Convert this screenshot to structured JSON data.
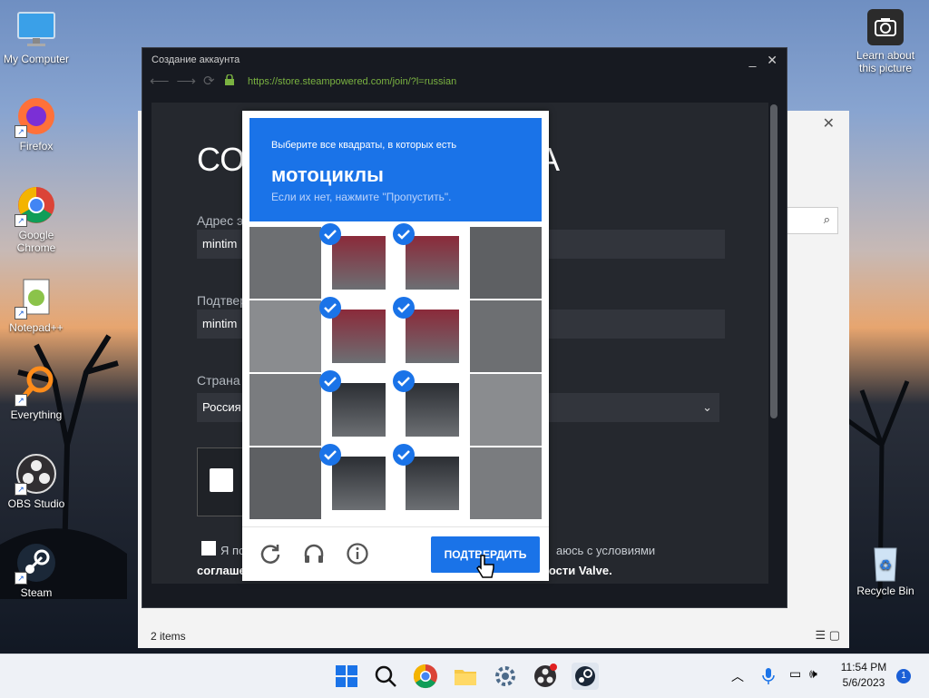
{
  "desktop": {
    "icons": [
      {
        "label": "My Computer"
      },
      {
        "label": "Firefox"
      },
      {
        "label": "Google Chrome"
      },
      {
        "label": "Notepad++"
      },
      {
        "label": "Everything"
      },
      {
        "label": "OBS Studio"
      },
      {
        "label": "Steam"
      }
    ],
    "learn_about": "Learn about this picture",
    "recycle_bin": "Recycle Bin"
  },
  "explorer": {
    "status_items": "2 items"
  },
  "steam_window": {
    "title": "Создание аккаунта",
    "url": "https://store.steampowered.com/join/?l=russian",
    "page_title_left": "СО",
    "page_title_right": "А",
    "email_label": "Адрес э",
    "email_value": "mintim",
    "confirm_label": "Подтвер",
    "confirm_value": "mintim",
    "country_label": "Страна",
    "country_value": "Россия",
    "agree_text_left": "Я по",
    "agree_text_right": "аюсь с условиями",
    "agreement_left": "соглаше",
    "agreement_right": "ности Valve."
  },
  "captcha": {
    "instruction": "Выберите все квадраты, в которых есть",
    "target": "мотоциклы",
    "hint": "Если их нет, нажмите \"Пропустить\".",
    "grid_selected": [
      [
        false,
        true,
        true,
        false
      ],
      [
        false,
        true,
        true,
        false
      ],
      [
        false,
        true,
        true,
        false
      ],
      [
        false,
        true,
        true,
        false
      ]
    ],
    "confirm_button": "ПОДТВЕРДИТЬ",
    "icons": [
      "reload-icon",
      "headphones-icon",
      "info-icon"
    ]
  },
  "taskbar": {
    "time": "11:54 PM",
    "date": "5/6/2023",
    "notifications": "1"
  },
  "colors": {
    "captcha_blue": "#1a73e8",
    "steam_bg": "#171a21",
    "url_green": "#7ab241"
  }
}
